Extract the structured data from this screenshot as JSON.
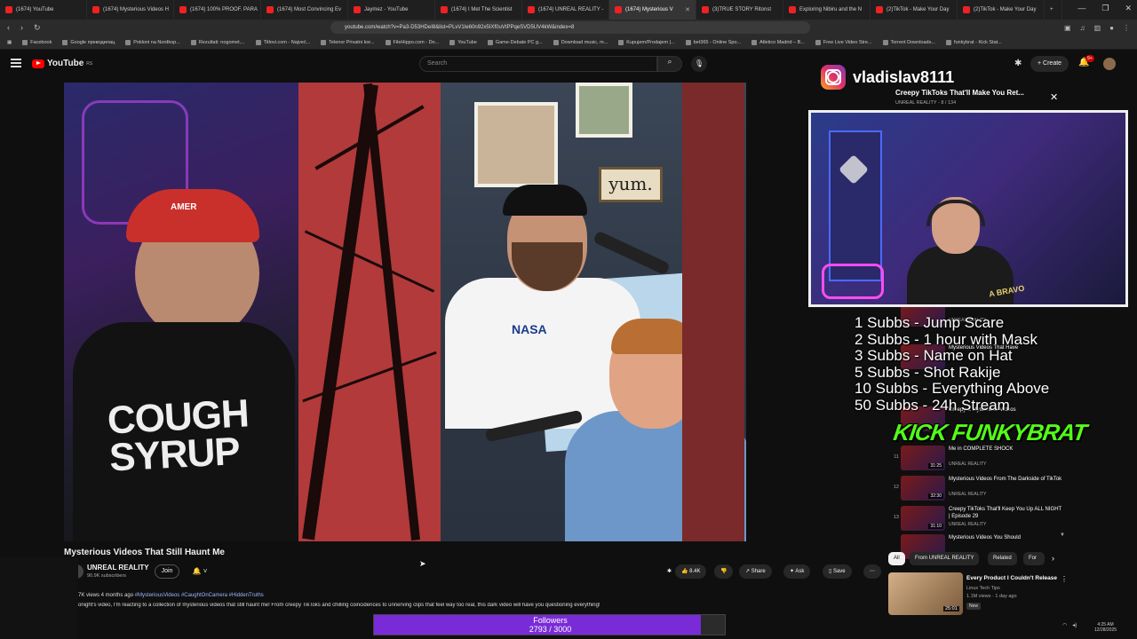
{
  "browser": {
    "tabs": [
      {
        "label": "(1674) YouTube",
        "active": false
      },
      {
        "label": "(1674) Mysterious Videos H",
        "active": false
      },
      {
        "label": "(1674) 100% PROOF. PARA",
        "active": false
      },
      {
        "label": "(1674) Most Convincing Ev",
        "active": false
      },
      {
        "label": "Jaymez - YouTube",
        "active": false
      },
      {
        "label": "(1674) I Met The Scientist",
        "active": false
      },
      {
        "label": "(1674) UNREAL REALITY -",
        "active": false
      },
      {
        "label": "(1674) Mysterious V",
        "active": true
      },
      {
        "label": "(3)TRUE STORY Ritonst",
        "active": false
      },
      {
        "label": "Exploring Nibiru and the N",
        "active": false
      },
      {
        "label": "(2)TikTok - Make Your Day",
        "active": false
      },
      {
        "label": "(2)TikTok - Make Your Day",
        "active": false
      }
    ],
    "url": "youtube.com/watch?v=Pa3-D53HDeI8&list=PLvV1Ie60n92x5IXf0uVtPPqeSVD5UV4kW&index=8",
    "bookmarks": [
      "Facebook",
      "Google преводилац",
      "Pokloni na Nordkop...",
      "Rezultati: nogomet,...",
      "Titlovi.com - Najveć...",
      "Telenor Privatni kor...",
      "FileHippo.com - Do...",
      "YouTube",
      "Game-Debate PC g...",
      "Download music, m...",
      "Kupujem/Prodajem |...",
      "bet365 - Online Spo...",
      "Atletico Madrid – B...",
      "Free Live Video Stre...",
      "Torrent Downloads...",
      "funkybrat - Kick Stat..."
    ]
  },
  "youtube": {
    "logo": "YouTube",
    "logo_region": "RS",
    "search_placeholder": "Search",
    "create_label": "Create",
    "notifications_badge": "9+",
    "video_title": "Mysterious Videos That Still Haunt Me",
    "channel_name": "UNREAL REALITY",
    "channel_subs": "90.9K subscribers",
    "join_label": "Join",
    "like_count": "8.4K",
    "share_label": "Share",
    "ask_label": "Ask",
    "save_label": "Save",
    "desc_meta": "7K views  4 months ago",
    "desc_tags": "#MysteriousVideos #CaughtOnCamera #HiddenTruths",
    "desc_text": "onight's video, I'm reacting to a collection of mysterious videos that still haunt me! From creepy TikToks and chilling coincidences to unnerving clips that feel way too real, this dark video will have you questioning everything!",
    "shirt_text": "COUGH SYRUP",
    "cap_text": "AMER",
    "frame_text": "yum.",
    "nasa_text": "NASA"
  },
  "playlist": {
    "title": "Creepy TikToks That'll Make You Ret...",
    "subtitle": "UNREAL REALITY - 8 / 134",
    "items": [
      {
        "num": "",
        "title": "",
        "channel": "UNREAL REALITY",
        "duration": ""
      },
      {
        "num": "",
        "title": "Mysterious Videos That Have",
        "channel": "",
        "duration": ""
      },
      {
        "num": "",
        "title": "Creepy & Mysterious Videos",
        "channel": "",
        "duration": ""
      },
      {
        "num": "11",
        "title": "Me in COMPLETE SHOCK",
        "channel": "UNREAL REALITY",
        "duration": "31:25"
      },
      {
        "num": "12",
        "title": "Mysterious Videos From The Darkside of TikTok",
        "channel": "UNREAL REALITY",
        "duration": "32:30"
      },
      {
        "num": "13",
        "title": "Creepy TikToks That'll Keep You Up ALL NIGHT | Episode 29",
        "channel": "UNREAL REALITY",
        "duration": "31:10"
      },
      {
        "num": "",
        "title": "Mysterious Videos You Should",
        "channel": "",
        "duration": ""
      }
    ],
    "chips": [
      "All",
      "From UNREAL REALITY",
      "Related",
      "For"
    ]
  },
  "recommended": {
    "title": "Every Product I Couldn't Release",
    "channel": "Linus Tech Tips",
    "meta": "1.1M views · 1 day ago",
    "badge": "New",
    "duration": "25:01"
  },
  "overlay": {
    "instagram_handle": "vladislav8111",
    "subs_goals": [
      "1 Subbs - Jump Scare",
      "2 Subbs - 1 hour with Mask",
      "3 Subbs - Name on Hat",
      "5 Subbs - Shot Rakije",
      "10 Subbs - Everything Above",
      "50 Subbs - 24h Stream"
    ],
    "kick_text": "KICK FUNKYBRAT",
    "webcam_text": "A BRAVO",
    "followers_label": "Followers",
    "followers_count": "2793 / 3000",
    "followers_value": 2793,
    "followers_goal": 3000
  },
  "system": {
    "time": "4:25 AM",
    "date": "12/28/2025"
  },
  "colors": {
    "followers_fill": "#7a2bd8",
    "kick_green": "#53fc18",
    "yt_red": "#ff0000"
  }
}
